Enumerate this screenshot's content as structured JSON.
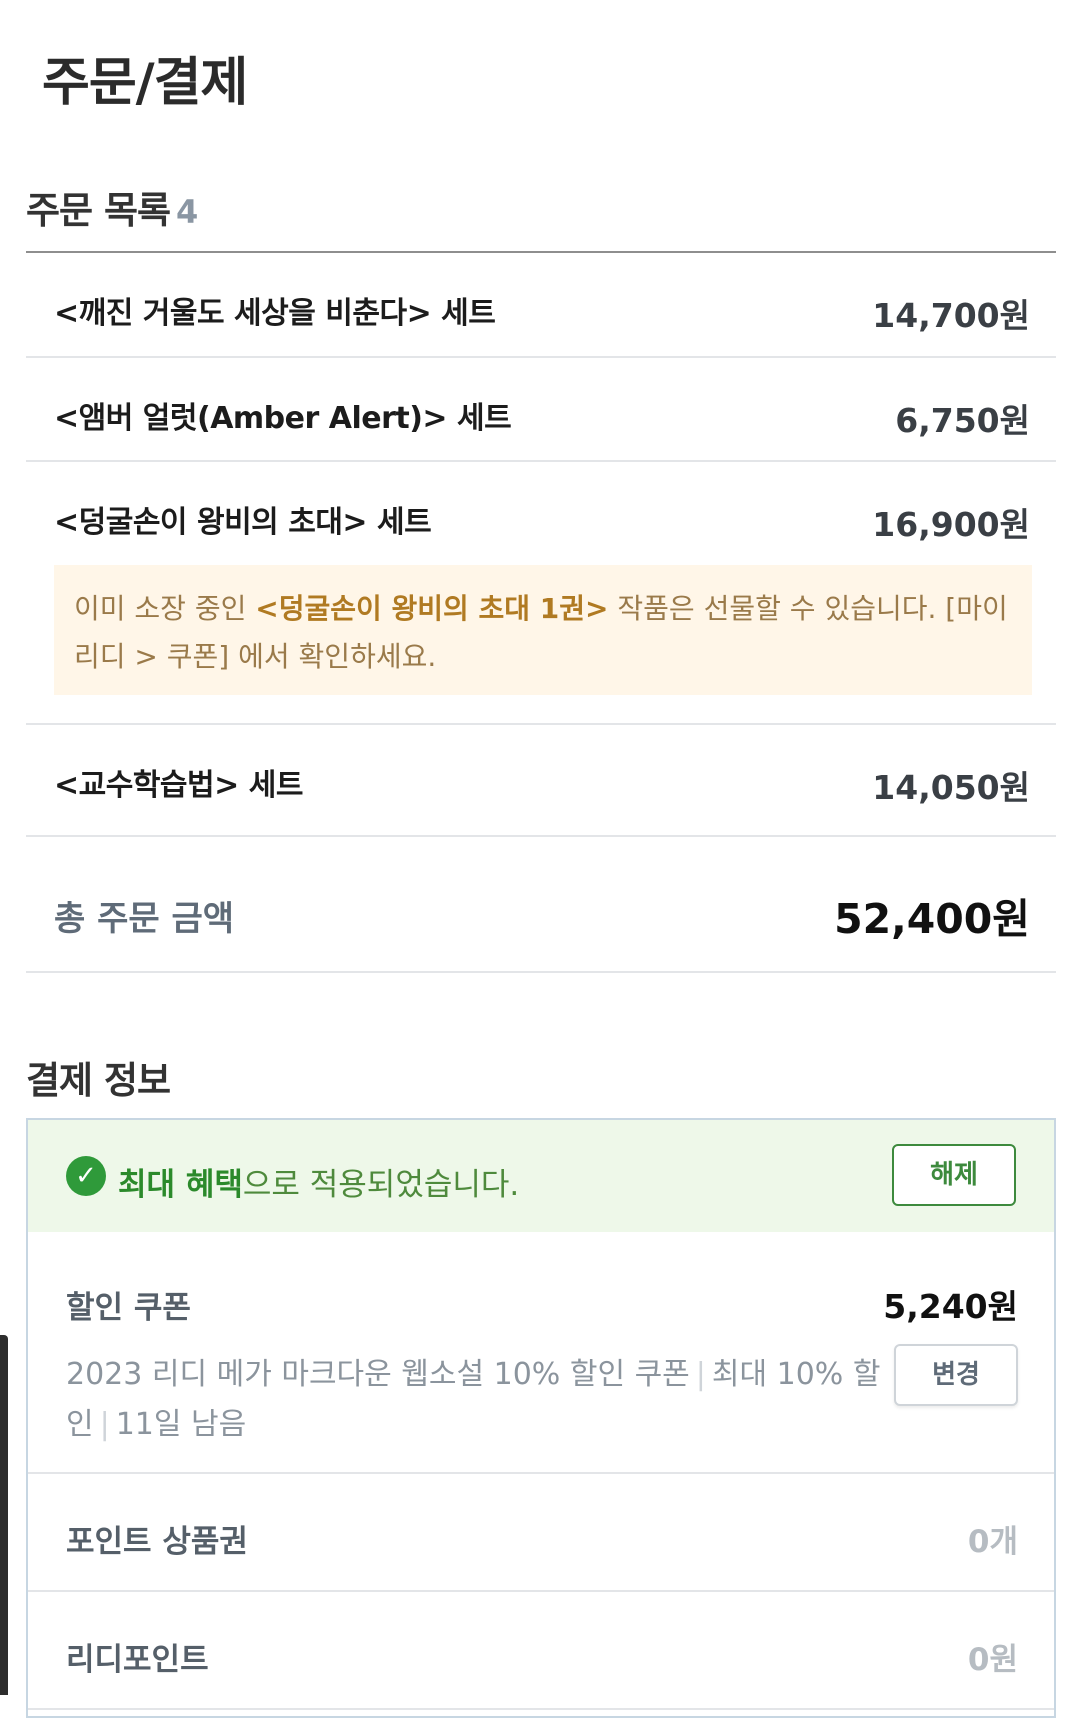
{
  "header": {
    "title": "주문/결제"
  },
  "order_section": {
    "title": "주문 목록",
    "count": "4",
    "items": [
      {
        "name": "<깨진 거울도 세상을 비춘다> 세트",
        "price": "14,700원"
      },
      {
        "name": "<앰버 얼럿(Amber Alert)> 세트",
        "price": "6,750원"
      },
      {
        "name": "<덩굴손이 왕비의 초대> 세트",
        "price": "16,900원"
      },
      {
        "name": "<교수학습법> 세트",
        "price": "14,050원"
      }
    ],
    "gift_notice": {
      "prefix": "이미 소장 중인 ",
      "highlight": "<덩굴손이 왕비의 초대 1권>",
      "suffix": " 작품은 선물할 수 있습니다. [마이리디 > 쿠폰] 에서 확인하세요."
    },
    "total_label": "총 주문 금액",
    "total_amount": "52,400원"
  },
  "payment_section": {
    "title": "결제 정보",
    "benefit": {
      "highlight": "최대 혜택",
      "text": "으로 적용되었습니다.",
      "release_label": "해제",
      "check_icon": "check-circle-icon",
      "color": "#2f9a3a"
    },
    "coupon": {
      "label": "할인 쿠폰",
      "amount": "5,240원",
      "desc_parts": [
        "2023 리디 메가 마크다운 웹소설 10% 할인 쿠폰",
        "최대 10% 할인",
        "11일 남음"
      ],
      "change_label": "변경"
    },
    "point_voucher": {
      "label": "포인트 상품권",
      "value": "0개"
    },
    "ridi_point": {
      "label": "리디포인트",
      "value": "0원"
    }
  }
}
